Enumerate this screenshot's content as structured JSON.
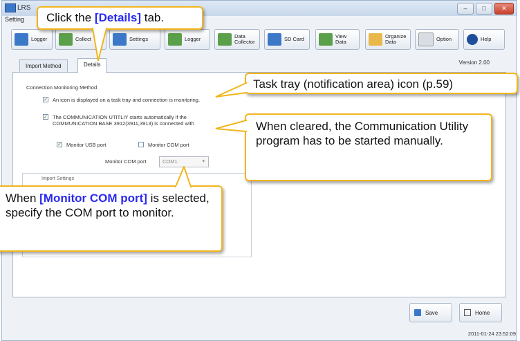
{
  "window": {
    "title": "LRS",
    "menu": "Setting",
    "controls": {
      "minimize": "–",
      "maximize": "□",
      "close": "✕"
    }
  },
  "toolbar": {
    "buttons": [
      {
        "label": "Logger",
        "icon": "logger-icon"
      },
      {
        "label": "Collect",
        "icon": "collect-icon"
      },
      {
        "label": "Settings",
        "icon": "settings-icon"
      },
      {
        "label": "Logger",
        "icon": "logger-icon"
      },
      {
        "label": "Data\nCollector",
        "icon": "data-collector-icon"
      },
      {
        "label": "SD Card",
        "icon": "sd-card-icon"
      },
      {
        "label": "View\nData",
        "icon": "view-data-icon"
      },
      {
        "label": "Organize\nData",
        "icon": "organize-data-icon"
      },
      {
        "label": "Option",
        "icon": "option-icon"
      },
      {
        "label": "Help",
        "icon": "help-icon"
      }
    ]
  },
  "tabs": [
    {
      "label": "Import Method",
      "active": false
    },
    {
      "label": "Details",
      "active": true
    }
  ],
  "version": "Version  2.00",
  "details": {
    "section_title": "Connection Monitoring Method",
    "icon_option": "An icon is displayed on a task tray and connection is monitoring.",
    "auto_start_line1": "The COMMUNICATION UTITLIY starts automatically if the",
    "auto_start_line2": "COMMUNICATION BASE 3912(3911,3913) is connected with",
    "monitor_usb": "Monitor USB port",
    "monitor_com": "Monitor COM port",
    "com_port_label": "Monitor COM port",
    "com_port_value": "COM1",
    "group_label": "Import Settings"
  },
  "actions": {
    "save": "Save",
    "home": "Home"
  },
  "timestamp": "2011-01-24 23:52:09",
  "callouts": {
    "details_tab": {
      "prefix": "Click the ",
      "highlight": "[Details]",
      "suffix": " tab."
    },
    "task_tray": "Task tray (notification area) icon (p.59)",
    "cleared": "When cleared, the Communication Utility program has to be started manually.",
    "monitor_com": {
      "prefix": "When ",
      "highlight": "[Monitor COM port]",
      "suffix": " is selected, specify the COM port to monitor."
    }
  },
  "colors": {
    "callout_border": "#f2b51c",
    "highlight": "#2a2aef"
  }
}
